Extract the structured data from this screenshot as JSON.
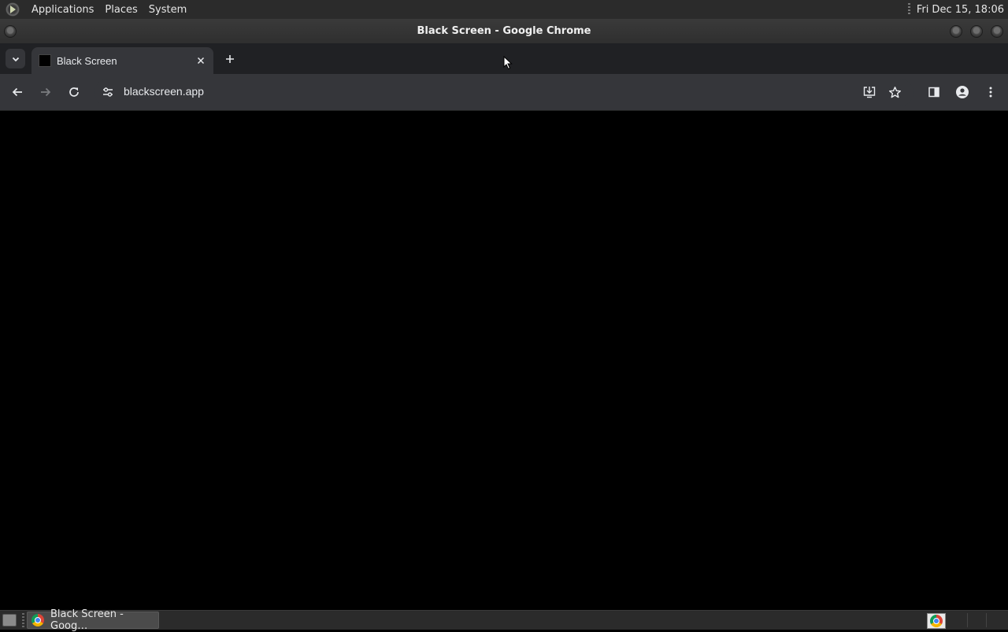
{
  "top_panel": {
    "menus": [
      "Applications",
      "Places",
      "System"
    ],
    "clock": "Fri Dec 15, 18:06"
  },
  "window": {
    "title": "Black Screen - Google Chrome"
  },
  "browser": {
    "tab": {
      "title": "Black Screen"
    },
    "omnibox": {
      "url": "blackscreen.app"
    }
  },
  "taskbar": {
    "task_label": "Black Screen - Goog…"
  },
  "icons": {
    "app-menu": "distro-logo-icon",
    "tab-search": "chevron-down-icon",
    "tab-close": "close-icon",
    "new-tab": "plus-icon",
    "back": "arrow-left-icon",
    "forward": "arrow-right-icon",
    "reload": "reload-icon",
    "site-info": "tune-icon",
    "install": "install-icon",
    "bookmark": "star-icon",
    "side-panel": "side-panel-icon",
    "profile": "profile-icon",
    "menu": "kebab-menu-icon"
  },
  "colors": {
    "page_background": "#000000",
    "toolbar": "#35363a",
    "tabstrip": "#202124"
  }
}
